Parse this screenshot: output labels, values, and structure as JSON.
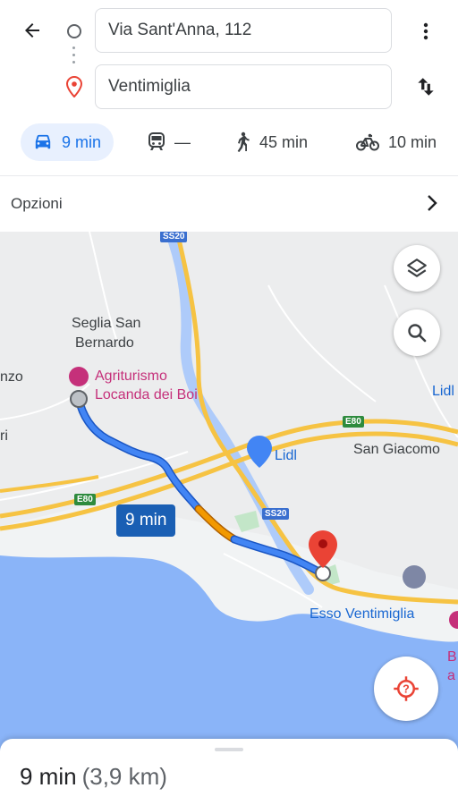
{
  "header": {
    "origin_value": "Via Sant'Anna, 112",
    "destination_value": "Ventimiglia",
    "back_icon": "arrow-left-icon",
    "menu_icon": "more-vert-icon",
    "swap_icon": "swap-vert-icon"
  },
  "modes": [
    {
      "icon": "car-icon",
      "label": "9 min",
      "active": true
    },
    {
      "icon": "train-icon",
      "label": "—",
      "active": false
    },
    {
      "icon": "walk-icon",
      "label": "45 min",
      "active": false
    },
    {
      "icon": "bike-icon",
      "label": "10 min",
      "active": false
    }
  ],
  "options": {
    "label": "Opzioni"
  },
  "map": {
    "labels": {
      "place1_line1": "Seglia San",
      "place1_line2": "Bernardo",
      "left_edge_1": "nzo",
      "left_edge_2": "ri",
      "san_giacomo": "San Giacomo",
      "lidl_right": "Lidl",
      "lidl_center": "Lidl",
      "poi_line1": "Agriturismo",
      "poi_line2": "Locanda dei Boi",
      "esso": "Esso Ventimiglia",
      "right_edge_1": "B",
      "right_edge_2": "a"
    },
    "road_shields": {
      "ss20_top": "SS20",
      "ss20_mid": "SS20",
      "e80_left": "E80",
      "e80_right": "E80"
    },
    "route_time": "9 min",
    "colors": {
      "route": "#4285f4",
      "traffic": "#f29900",
      "pin": "#ea4335",
      "water": "#8ab4f8"
    }
  },
  "sheet": {
    "duration": "9 min",
    "distance": "(3,9 km)"
  }
}
